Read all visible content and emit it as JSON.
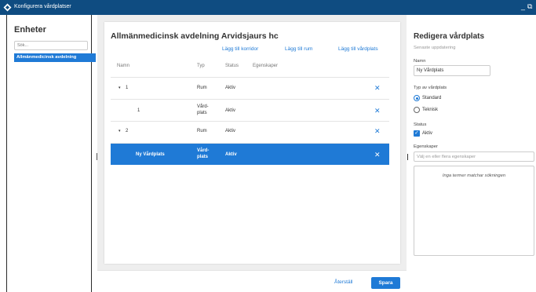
{
  "window": {
    "title": "Konfigurera vårdplatser",
    "minimize": "_",
    "restore": "⧉"
  },
  "units_panel": {
    "heading": "Enheter",
    "search_placeholder": "Sök...",
    "items": [
      {
        "label": "Allmänmedicinsk avdelning",
        "selected": true
      }
    ]
  },
  "main": {
    "title": "Allmänmedicinsk avdelning Arvidsjaurs hc",
    "actions": {
      "add_corridor": "Lägg till korridor",
      "add_room": "Lägg till rum",
      "add_bed": "Lägg till vårdplats"
    },
    "columns": {
      "name": "Namn",
      "type": "Typ",
      "status": "Status",
      "properties": "Egenskaper"
    },
    "rows": [
      {
        "expander": "▾",
        "name": "1",
        "type": "Rum",
        "status": "Aktiv",
        "remove": "✕"
      },
      {
        "name": "1",
        "type": "Vård-\nplats",
        "status": "Aktiv",
        "remove": "✕"
      },
      {
        "expander": "▾",
        "name": "2",
        "type": "Rum",
        "status": "Aktiv",
        "remove": "✕"
      },
      {
        "name": "Ny Vårdplats",
        "type": "Vård-\nplats",
        "status": "Aktiv",
        "remove": "✕",
        "selected": true
      }
    ]
  },
  "footer": {
    "reset": "Återställ",
    "save": "Spara"
  },
  "editor": {
    "heading": "Redigera vårdplats",
    "subtitle": "Senaste uppdatering",
    "name_label": "Namn",
    "name_value": "Ny Vårdplats",
    "type_label": "Typ av vårdplats",
    "type_options": [
      {
        "label": "Standard",
        "checked": true
      },
      {
        "label": "Teknisk",
        "checked": false
      }
    ],
    "status_label": "Status",
    "status_checkbox": "Aktiv",
    "status_checked": true,
    "properties_label": "Egenskaper",
    "properties_placeholder": "Välj en eller flera egenskaper",
    "no_match": "Inga termer matchar sökningen"
  },
  "colors": {
    "titlebar": "#0f4c81",
    "accent": "#1f7ad6",
    "center_bg": "#eeeeee"
  }
}
